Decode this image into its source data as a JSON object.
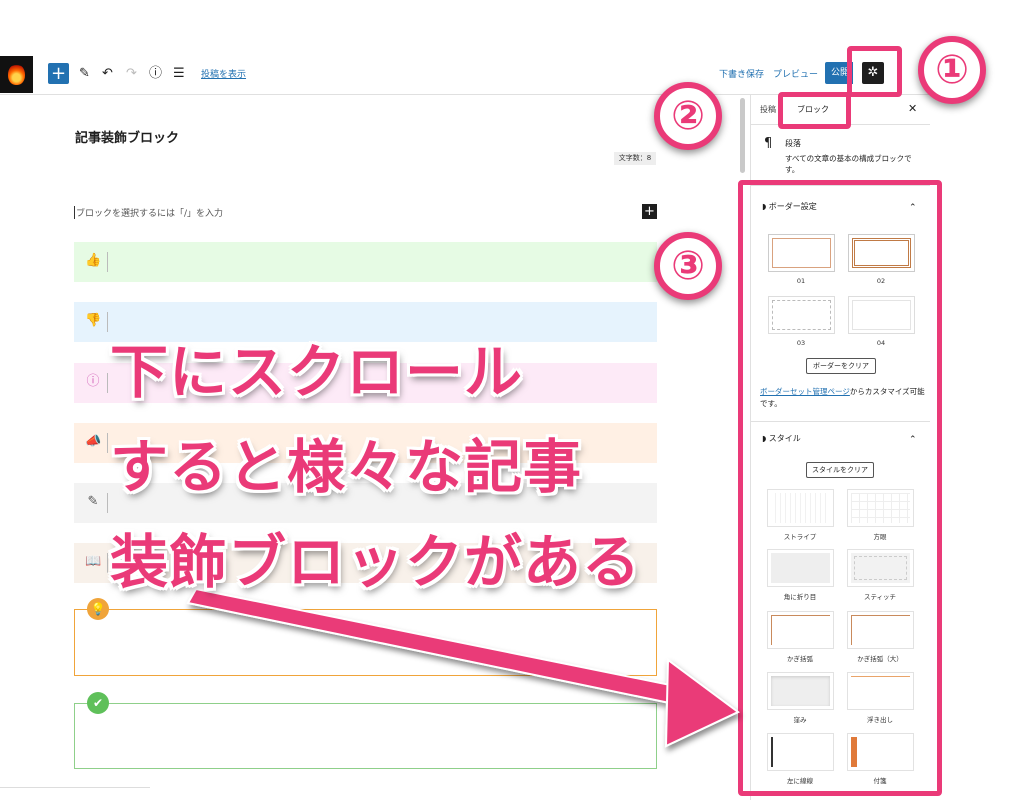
{
  "toolbar": {
    "add_label": "+",
    "pen_icon": "✎",
    "undo_icon": "↶",
    "redo_icon": "↷",
    "info_icon": "ⓘ",
    "list_icon": "☰",
    "view_post": "投稿を表示",
    "save_draft": "下書き保存",
    "preview": "プレビュー",
    "publish": "公開",
    "settings_icon": "✲"
  },
  "editor": {
    "post_title": "記事装飾ブロック",
    "word_count": "文字数：8",
    "placeholder": "ブロックを選択するには「/」を入力",
    "add_icon": "+",
    "blocks": [
      {
        "icon": "👍",
        "bg": "#e6fbe4",
        "color": "#2fb344"
      },
      {
        "icon": "👎",
        "bg": "#e6f3fd",
        "color": "#3e7bd6"
      },
      {
        "icon": "ⓘ",
        "bg": "#fdeaf7",
        "color": "#d260b8"
      },
      {
        "icon": "📣",
        "bg": "#fff0e4",
        "color": "#f08d3c"
      },
      {
        "icon": "✎",
        "bg": "#f3f3f3",
        "color": "#555555"
      },
      {
        "icon": "📖",
        "bg": "#f8f1ea",
        "color": "#8a6a4a"
      }
    ],
    "boxes": [
      {
        "icon": "💡",
        "border": "#f0a43a",
        "badge": "#f0a43a"
      },
      {
        "icon": "✔",
        "border": "#8fd08a",
        "badge": "#5fc05a"
      }
    ]
  },
  "sidebar": {
    "tab_post": "投稿",
    "tab_block": "ブロック",
    "close_icon": "✕",
    "paragraph_icon": "¶",
    "paragraph_name": "段落",
    "paragraph_desc": "すべての文章の基本の構成ブロックです。",
    "border_panel": {
      "title": "ボーダー設定",
      "options": [
        "01",
        "02",
        "03",
        "04"
      ],
      "clear_button": "ボーダーをクリア",
      "note_link": "ボーダーセット管理ページ",
      "note_rest": "からカスタマイズ可能です。"
    },
    "style_panel": {
      "title": "スタイル",
      "clear_button": "スタイルをクリア",
      "options": [
        "ストライプ",
        "方眼",
        "角に折り目",
        "スティッチ",
        "かぎ括弧",
        "かぎ括弧（大）",
        "窪み",
        "浮き出し",
        "左に線線",
        "付箋"
      ]
    },
    "chevron_icon": "⌃",
    "leaf_icon": "◗"
  },
  "annotations": {
    "num1": "①",
    "num2": "②",
    "num3": "③",
    "line1": "下にスクロール",
    "line2": "すると様々な記事",
    "line3": "装飾ブロックがある",
    "accent": "#ea3a78"
  }
}
